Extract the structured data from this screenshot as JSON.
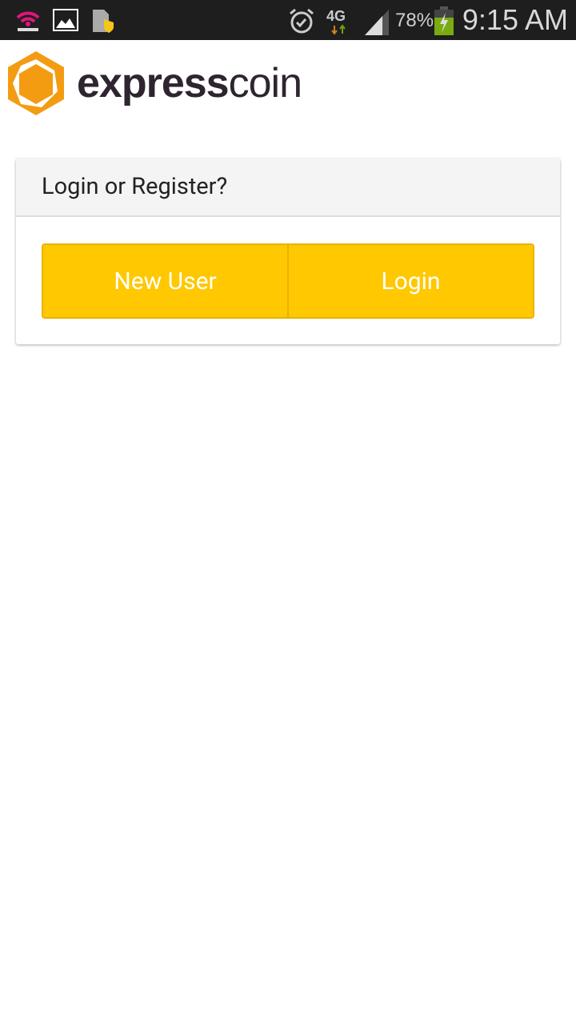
{
  "status_bar": {
    "battery_percent": "78%",
    "time": "9:15 AM",
    "network": "4G",
    "icons": [
      "hotspot-icon",
      "gallery-icon",
      "security-icon",
      "alarm-icon",
      "4g-icon",
      "signal-icon",
      "battery-charging-icon"
    ]
  },
  "brand": {
    "logo_text_bold": "express",
    "logo_text_light": "coin",
    "color": "#f39c12"
  },
  "card": {
    "title": "Login or Register?",
    "new_user_label": "New User",
    "login_label": "Login",
    "button_color": "#ffc800"
  }
}
